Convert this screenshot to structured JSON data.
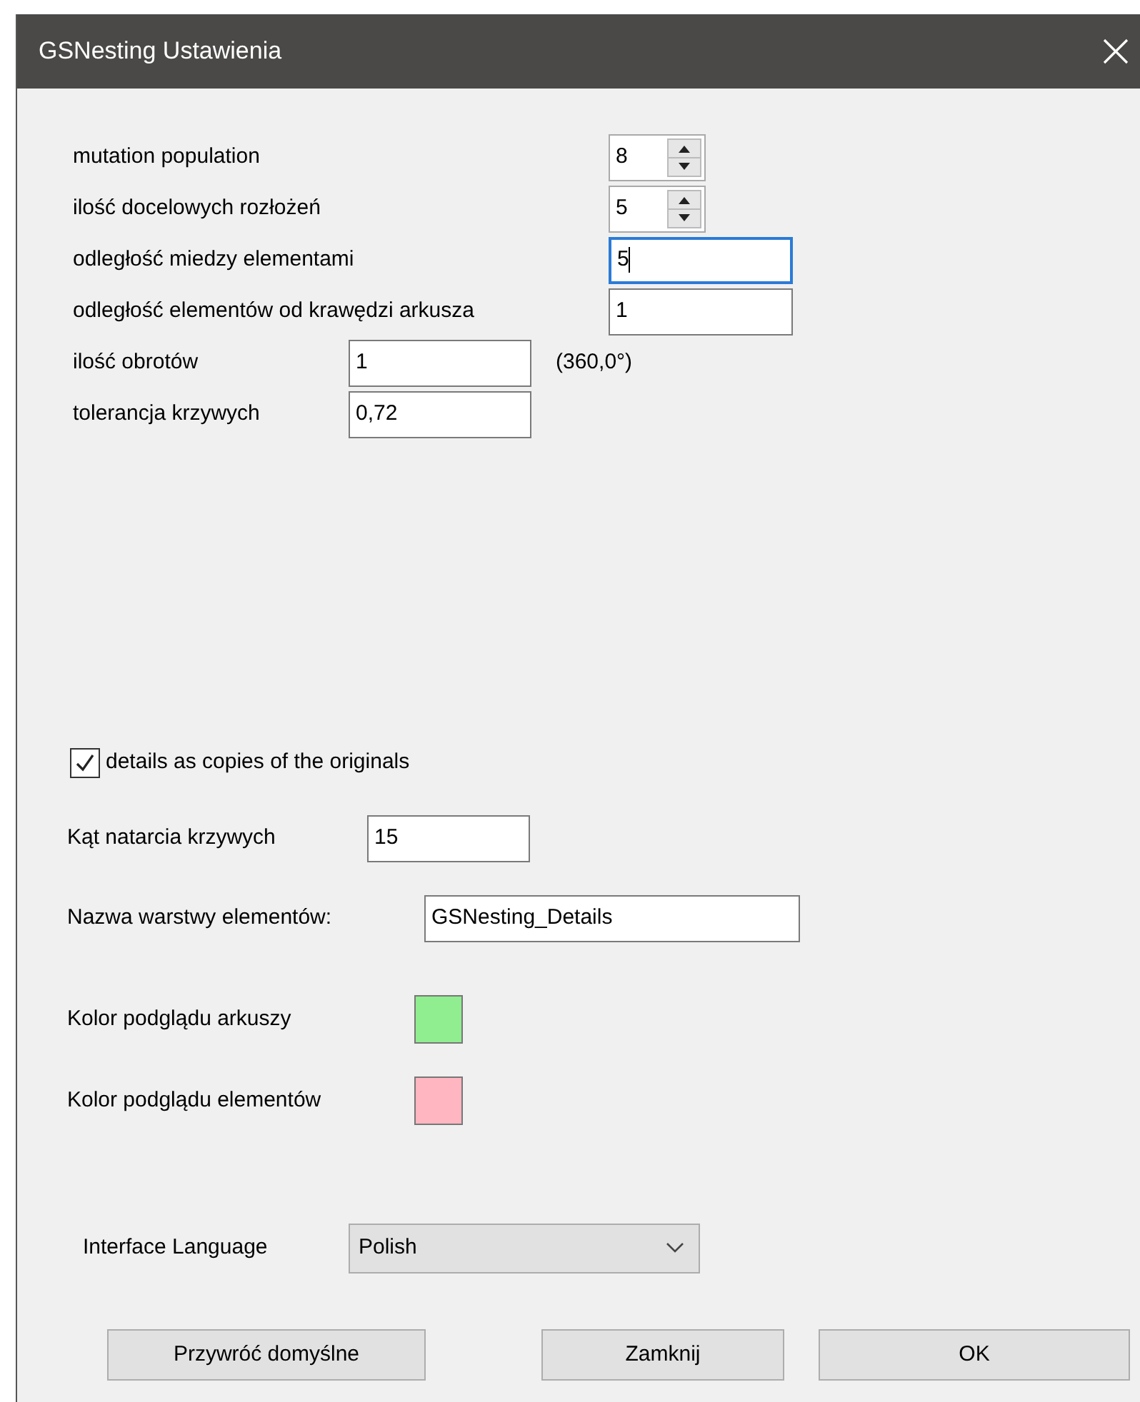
{
  "window": {
    "title": "GSNesting Ustawienia"
  },
  "fields": [
    {
      "label": "mutation population",
      "value": "8",
      "kind": "spin",
      "focused": false
    },
    {
      "label": "ilość docelowych rozłożeń",
      "value": "5",
      "kind": "spin",
      "focused": false
    },
    {
      "label": "odległość miedzy elementami",
      "value": "5",
      "kind": "text",
      "focused": true
    },
    {
      "label": "odległość elementów od krawędzi arkusza",
      "value": "1",
      "kind": "text",
      "focused": false
    },
    {
      "label": "ilość obrotów",
      "value": "1",
      "kind": "short",
      "focused": false,
      "note": "(360,0°)"
    },
    {
      "label": "tolerancja krzywych",
      "value": "0,72",
      "kind": "short",
      "focused": false
    }
  ],
  "copies_checkbox": {
    "label": "details as copies of the originals",
    "checked": true
  },
  "curve_angle": {
    "label": "Kąt natarcia krzywych",
    "value": "15"
  },
  "layer_name": {
    "label": "Nazwa warstwy elementów:",
    "value": "GSNesting_Details"
  },
  "colors": [
    {
      "label": "Kolor podglądu arkuszy",
      "color": "#90ee90"
    },
    {
      "label": "Kolor podglądu elementów",
      "color": "#ffb6c1"
    }
  ],
  "language": {
    "label": "Interface Language",
    "value": "Polish"
  },
  "buttons": [
    {
      "label": "Przywróć domyślne"
    },
    {
      "label": "Zamknij"
    },
    {
      "label": "OK"
    }
  ]
}
